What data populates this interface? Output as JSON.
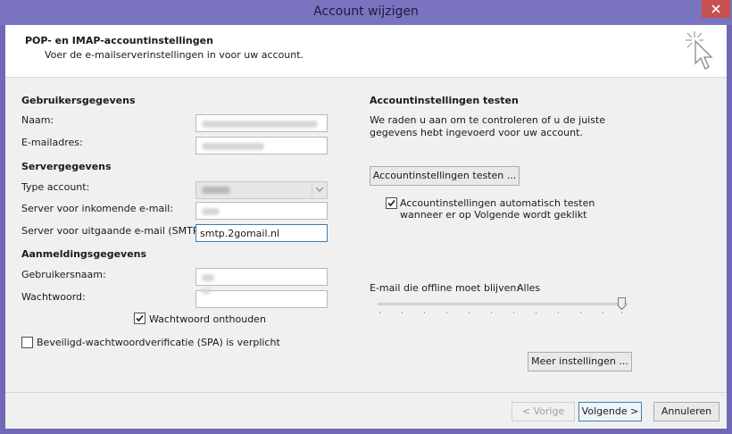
{
  "window": {
    "title": "Account wijzigen"
  },
  "header": {
    "title": "POP- en IMAP-accountinstellingen",
    "subtitle": "Voer de e-mailserverinstellingen in voor uw account."
  },
  "user_info": {
    "heading": "Gebruikersgegevens",
    "name_label": "Naam:",
    "email_label": "E-mailadres:"
  },
  "server_info": {
    "heading": "Servergegevens",
    "account_type_label": "Type account:",
    "incoming_label": "Server voor inkomende e-mail:",
    "outgoing_label": "Server voor uitgaande e-mail (SMTP):",
    "outgoing_value": "smtp.2gomail.nl"
  },
  "logon_info": {
    "heading": "Aanmeldingsgegevens",
    "username_label": "Gebruikersnaam:",
    "password_label": "Wachtwoord:",
    "remember_password_label": "Wachtwoord onthouden",
    "remember_password_checked": true,
    "spa_label": "Beveiligd-wachtwoordverificatie (SPA) is verplicht",
    "spa_checked": false
  },
  "test": {
    "heading": "Accountinstellingen testen",
    "description_line1": "We raden u aan om te controleren of u de juiste",
    "description_line2": "gegevens hebt ingevoerd voor uw account.",
    "button_label": "Accountinstellingen testen ...",
    "auto_test_line1": "Accountinstellingen automatisch testen",
    "auto_test_line2": "wanneer er op Volgende wordt geklikt",
    "auto_test_checked": true
  },
  "offline": {
    "label": "E-mail die offline moet blijven:",
    "value": "Alles",
    "slider_fraction": 1.0
  },
  "buttons": {
    "more_settings": "Meer instellingen ...",
    "back": "< Vorige",
    "next": "Volgende >",
    "cancel": "Annuleren"
  },
  "colors": {
    "titlebar": "#7a73c0",
    "close_button": "#c7504f",
    "accent_border": "#3c7fb1"
  }
}
